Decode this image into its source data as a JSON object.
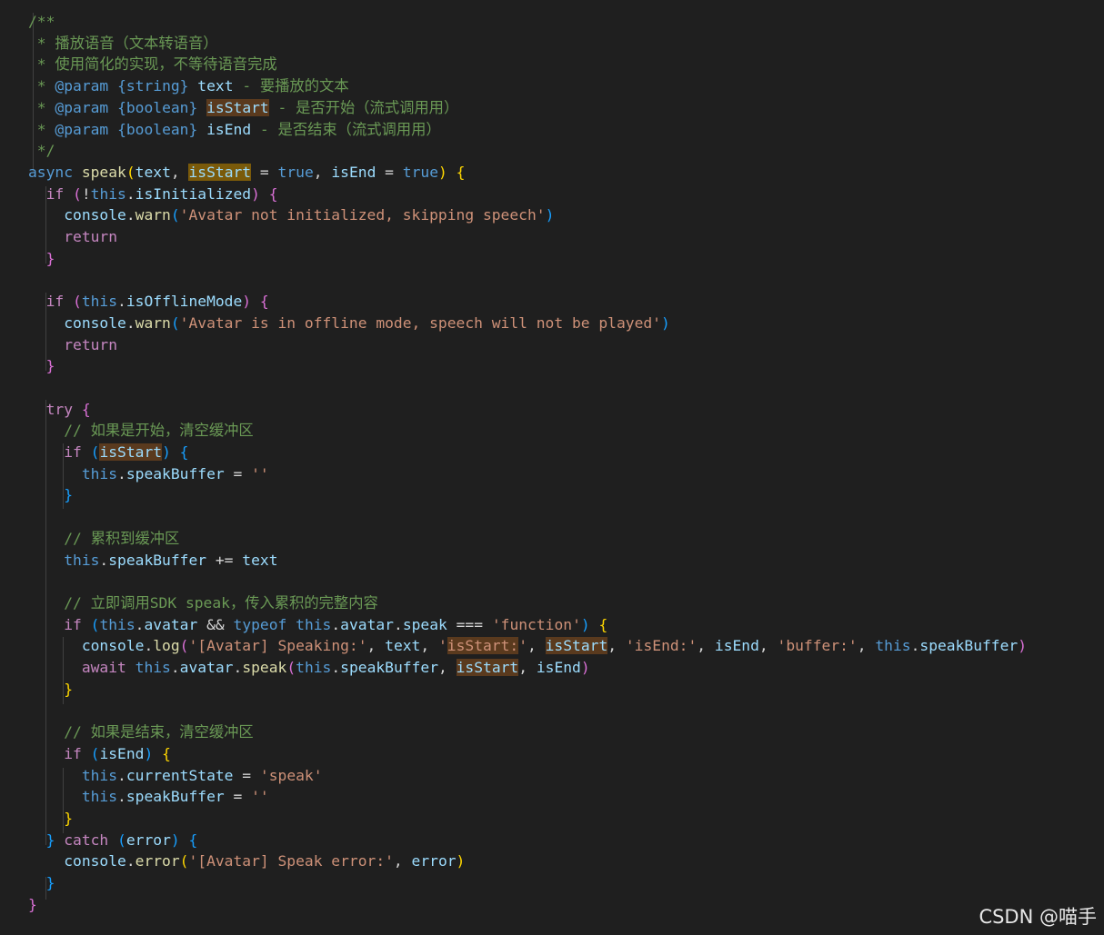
{
  "editor": {
    "background": "#1f1f1f",
    "lines": [
      [
        {
          "t": "/**",
          "c": "com"
        }
      ],
      [
        {
          "t": " * 播放语音（文本转语音）",
          "c": "com"
        }
      ],
      [
        {
          "t": " * 使用简化的实现，不等待语音完成",
          "c": "com"
        }
      ],
      [
        {
          "t": " * ",
          "c": "com"
        },
        {
          "t": "@param",
          "c": "doc"
        },
        {
          "t": " ",
          "c": "com"
        },
        {
          "t": "{string}",
          "c": "doc"
        },
        {
          "t": " ",
          "c": "com"
        },
        {
          "t": "text",
          "c": "var"
        },
        {
          "t": " - 要播放的文本",
          "c": "com"
        }
      ],
      [
        {
          "t": " * ",
          "c": "com"
        },
        {
          "t": "@param",
          "c": "doc"
        },
        {
          "t": " ",
          "c": "com"
        },
        {
          "t": "{boolean}",
          "c": "doc"
        },
        {
          "t": " ",
          "c": "com"
        },
        {
          "t": "isStart",
          "c": "var",
          "hl": true
        },
        {
          "t": " - 是否开始（流式调用用）",
          "c": "com"
        }
      ],
      [
        {
          "t": " * ",
          "c": "com"
        },
        {
          "t": "@param",
          "c": "doc"
        },
        {
          "t": " ",
          "c": "com"
        },
        {
          "t": "{boolean}",
          "c": "doc"
        },
        {
          "t": " ",
          "c": "com"
        },
        {
          "t": "isEnd",
          "c": "var"
        },
        {
          "t": " - 是否结束（流式调用用）",
          "c": "com"
        }
      ],
      [
        {
          "t": " */",
          "c": "com"
        }
      ],
      [
        {
          "t": "async ",
          "c": "kw"
        },
        {
          "t": "speak",
          "c": "fn"
        },
        {
          "t": "(",
          "c": "b1"
        },
        {
          "t": "text",
          "c": "var"
        },
        {
          "t": ", ",
          "c": "def"
        },
        {
          "t": "isStart",
          "c": "var",
          "hl": "strong"
        },
        {
          "t": " = ",
          "c": "op"
        },
        {
          "t": "true",
          "c": "kw"
        },
        {
          "t": ", ",
          "c": "def"
        },
        {
          "t": "isEnd",
          "c": "var"
        },
        {
          "t": " = ",
          "c": "op"
        },
        {
          "t": "true",
          "c": "kw"
        },
        {
          "t": ") ",
          "c": "b1"
        },
        {
          "t": "{",
          "c": "b1"
        }
      ],
      [
        {
          "t": "  if ",
          "c": "ctl"
        },
        {
          "t": "(",
          "c": "b2"
        },
        {
          "t": "!",
          "c": "op"
        },
        {
          "t": "this",
          "c": "kw"
        },
        {
          "t": ".",
          "c": "def"
        },
        {
          "t": "isInitialized",
          "c": "var"
        },
        {
          "t": ") ",
          "c": "b2"
        },
        {
          "t": "{",
          "c": "b2"
        }
      ],
      [
        {
          "t": "    console",
          "c": "var"
        },
        {
          "t": ".",
          "c": "def"
        },
        {
          "t": "warn",
          "c": "fn"
        },
        {
          "t": "(",
          "c": "b3"
        },
        {
          "t": "'Avatar not initialized, skipping speech'",
          "c": "str"
        },
        {
          "t": ")",
          "c": "b3"
        }
      ],
      [
        {
          "t": "    return",
          "c": "ctl"
        }
      ],
      [
        {
          "t": "  }",
          "c": "b2"
        }
      ],
      [],
      [
        {
          "t": "  if ",
          "c": "ctl"
        },
        {
          "t": "(",
          "c": "b2"
        },
        {
          "t": "this",
          "c": "kw"
        },
        {
          "t": ".",
          "c": "def"
        },
        {
          "t": "isOfflineMode",
          "c": "var"
        },
        {
          "t": ") ",
          "c": "b2"
        },
        {
          "t": "{",
          "c": "b2"
        }
      ],
      [
        {
          "t": "    console",
          "c": "var"
        },
        {
          "t": ".",
          "c": "def"
        },
        {
          "t": "warn",
          "c": "fn"
        },
        {
          "t": "(",
          "c": "b3"
        },
        {
          "t": "'Avatar is in offline mode, speech will not be played'",
          "c": "str"
        },
        {
          "t": ")",
          "c": "b3"
        }
      ],
      [
        {
          "t": "    return",
          "c": "ctl"
        }
      ],
      [
        {
          "t": "  }",
          "c": "b2"
        }
      ],
      [],
      [
        {
          "t": "  try ",
          "c": "ctl"
        },
        {
          "t": "{",
          "c": "b2"
        }
      ],
      [
        {
          "t": "    // 如果是开始，清空缓冲区",
          "c": "com"
        }
      ],
      [
        {
          "t": "    if ",
          "c": "ctl"
        },
        {
          "t": "(",
          "c": "b3"
        },
        {
          "t": "isStart",
          "c": "var",
          "hl": true
        },
        {
          "t": ") ",
          "c": "b3"
        },
        {
          "t": "{",
          "c": "b3"
        }
      ],
      [
        {
          "t": "      this",
          "c": "kw"
        },
        {
          "t": ".",
          "c": "def"
        },
        {
          "t": "speakBuffer",
          "c": "var"
        },
        {
          "t": " = ",
          "c": "op"
        },
        {
          "t": "''",
          "c": "str"
        }
      ],
      [
        {
          "t": "    }",
          "c": "b3"
        }
      ],
      [],
      [
        {
          "t": "    // 累积到缓冲区",
          "c": "com"
        }
      ],
      [
        {
          "t": "    this",
          "c": "kw"
        },
        {
          "t": ".",
          "c": "def"
        },
        {
          "t": "speakBuffer",
          "c": "var"
        },
        {
          "t": " += ",
          "c": "op"
        },
        {
          "t": "text",
          "c": "var"
        }
      ],
      [],
      [
        {
          "t": "    // 立即调用SDK speak，传入累积的完整内容",
          "c": "com"
        }
      ],
      [
        {
          "t": "    if ",
          "c": "ctl"
        },
        {
          "t": "(",
          "c": "b3"
        },
        {
          "t": "this",
          "c": "kw"
        },
        {
          "t": ".",
          "c": "def"
        },
        {
          "t": "avatar",
          "c": "var"
        },
        {
          "t": " && ",
          "c": "op"
        },
        {
          "t": "typeof ",
          "c": "kw"
        },
        {
          "t": "this",
          "c": "kw"
        },
        {
          "t": ".",
          "c": "def"
        },
        {
          "t": "avatar",
          "c": "var"
        },
        {
          "t": ".",
          "c": "def"
        },
        {
          "t": "speak",
          "c": "var"
        },
        {
          "t": " === ",
          "c": "op"
        },
        {
          "t": "'function'",
          "c": "str"
        },
        {
          "t": ") ",
          "c": "b3"
        },
        {
          "t": "{",
          "c": "b1"
        }
      ],
      [
        {
          "t": "      console",
          "c": "var"
        },
        {
          "t": ".",
          "c": "def"
        },
        {
          "t": "log",
          "c": "fn"
        },
        {
          "t": "(",
          "c": "b2"
        },
        {
          "t": "'[Avatar] Speaking:'",
          "c": "str"
        },
        {
          "t": ", ",
          "c": "def"
        },
        {
          "t": "text",
          "c": "var"
        },
        {
          "t": ", ",
          "c": "def"
        },
        {
          "t": "'",
          "c": "str"
        },
        {
          "t": "isStart:",
          "c": "str",
          "hl": true
        },
        {
          "t": "'",
          "c": "str"
        },
        {
          "t": ", ",
          "c": "def"
        },
        {
          "t": "isStart",
          "c": "var",
          "hl": true
        },
        {
          "t": ", ",
          "c": "def"
        },
        {
          "t": "'isEnd:'",
          "c": "str"
        },
        {
          "t": ", ",
          "c": "def"
        },
        {
          "t": "isEnd",
          "c": "var"
        },
        {
          "t": ", ",
          "c": "def"
        },
        {
          "t": "'buffer:'",
          "c": "str"
        },
        {
          "t": ", ",
          "c": "def"
        },
        {
          "t": "this",
          "c": "kw"
        },
        {
          "t": ".",
          "c": "def"
        },
        {
          "t": "speakBuffer",
          "c": "var"
        },
        {
          "t": ")",
          "c": "b2"
        }
      ],
      [
        {
          "t": "      await ",
          "c": "ctl"
        },
        {
          "t": "this",
          "c": "kw"
        },
        {
          "t": ".",
          "c": "def"
        },
        {
          "t": "avatar",
          "c": "var"
        },
        {
          "t": ".",
          "c": "def"
        },
        {
          "t": "speak",
          "c": "fn"
        },
        {
          "t": "(",
          "c": "b2"
        },
        {
          "t": "this",
          "c": "kw"
        },
        {
          "t": ".",
          "c": "def"
        },
        {
          "t": "speakBuffer",
          "c": "var"
        },
        {
          "t": ", ",
          "c": "def"
        },
        {
          "t": "isStart",
          "c": "var",
          "hl": true
        },
        {
          "t": ", ",
          "c": "def"
        },
        {
          "t": "isEnd",
          "c": "var"
        },
        {
          "t": ")",
          "c": "b2"
        }
      ],
      [
        {
          "t": "    }",
          "c": "b1"
        }
      ],
      [],
      [
        {
          "t": "    // 如果是结束，清空缓冲区",
          "c": "com"
        }
      ],
      [
        {
          "t": "    if ",
          "c": "ctl"
        },
        {
          "t": "(",
          "c": "b3"
        },
        {
          "t": "isEnd",
          "c": "var"
        },
        {
          "t": ") ",
          "c": "b3"
        },
        {
          "t": "{",
          "c": "b1"
        }
      ],
      [
        {
          "t": "      this",
          "c": "kw"
        },
        {
          "t": ".",
          "c": "def"
        },
        {
          "t": "currentState",
          "c": "var"
        },
        {
          "t": " = ",
          "c": "op"
        },
        {
          "t": "'speak'",
          "c": "str"
        }
      ],
      [
        {
          "t": "      this",
          "c": "kw"
        },
        {
          "t": ".",
          "c": "def"
        },
        {
          "t": "speakBuffer",
          "c": "var"
        },
        {
          "t": " = ",
          "c": "op"
        },
        {
          "t": "''",
          "c": "str"
        }
      ],
      [
        {
          "t": "    }",
          "c": "b1"
        }
      ],
      [
        {
          "t": "  } ",
          "c": "b3"
        },
        {
          "t": "catch ",
          "c": "ctl"
        },
        {
          "t": "(",
          "c": "b3"
        },
        {
          "t": "error",
          "c": "var"
        },
        {
          "t": ") ",
          "c": "b3"
        },
        {
          "t": "{",
          "c": "b3"
        }
      ],
      [
        {
          "t": "    console",
          "c": "var"
        },
        {
          "t": ".",
          "c": "def"
        },
        {
          "t": "error",
          "c": "fn"
        },
        {
          "t": "(",
          "c": "b1"
        },
        {
          "t": "'[Avatar] Speak error:'",
          "c": "str"
        },
        {
          "t": ", ",
          "c": "def"
        },
        {
          "t": "error",
          "c": "var"
        },
        {
          "t": ")",
          "c": "b1"
        }
      ],
      [
        {
          "t": "  }",
          "c": "b3"
        }
      ],
      [
        {
          "t": "}",
          "c": "b2"
        }
      ]
    ]
  },
  "watermark": "CSDN @喵手"
}
